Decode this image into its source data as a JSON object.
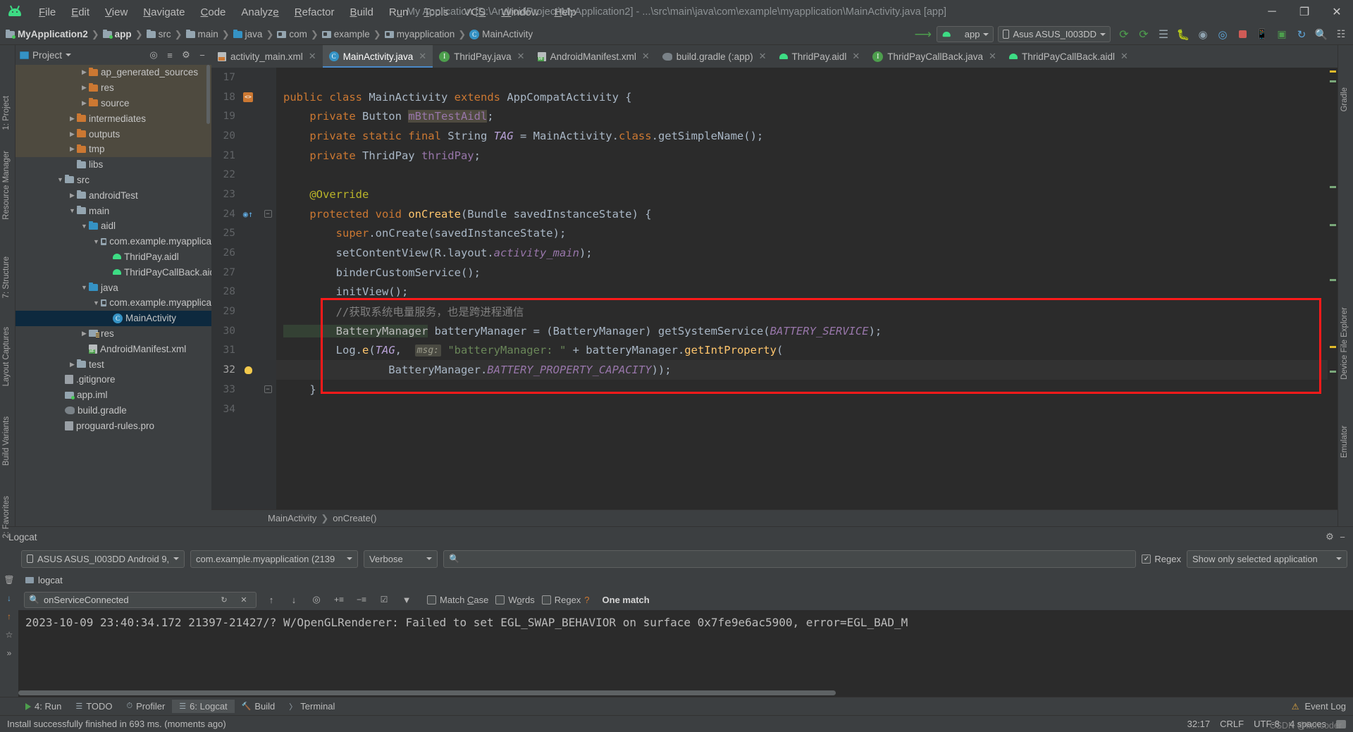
{
  "window": {
    "title": "My Application [D:\\AndroidProject\\MyApplication2] - ...\\src\\main\\java\\com\\example\\myapplication\\MainActivity.java [app]",
    "minimize": "─",
    "maximize": "❐",
    "close": "✕"
  },
  "menu": [
    {
      "label": "File"
    },
    {
      "label": "Edit"
    },
    {
      "label": "View"
    },
    {
      "label": "Navigate"
    },
    {
      "label": "Code"
    },
    {
      "label": "Analyze"
    },
    {
      "label": "Refactor"
    },
    {
      "label": "Build"
    },
    {
      "label": "Run"
    },
    {
      "label": "Tools"
    },
    {
      "label": "VCS"
    },
    {
      "label": "Window"
    },
    {
      "label": "Help"
    }
  ],
  "breadcrumb": [
    {
      "label": "MyApplication2",
      "icon": "folder-icon"
    },
    {
      "label": "app",
      "icon": "module-folder-icon"
    },
    {
      "label": "src",
      "icon": "folder-icon"
    },
    {
      "label": "main",
      "icon": "folder-icon"
    },
    {
      "label": "java",
      "icon": "source-folder-icon"
    },
    {
      "label": "com",
      "icon": "package-icon"
    },
    {
      "label": "example",
      "icon": "package-icon"
    },
    {
      "label": "myapplication",
      "icon": "package-icon"
    },
    {
      "label": "MainActivity",
      "icon": "class-icon"
    }
  ],
  "toolbar": {
    "run_config": "app",
    "device": "Asus ASUS_I003DD",
    "icons": [
      "run-icon",
      "debug-icon",
      "apply-changes-icon",
      "bug-icon",
      "profile-icon",
      "attach-debugger-icon",
      "stop-icon",
      "avd-manager-icon",
      "sdk-manager-icon",
      "sync-gradle-icon",
      "search-icon",
      "layout-inspector-icon"
    ]
  },
  "left_strip": {
    "project_label": "1: Project",
    "resource_manager_label": "Resource Manager",
    "structure_label": "7: Structure",
    "layout_captures_label": "Layout Captures",
    "build_variants_label": "Build Variants",
    "favorites_label": "2: Favorites"
  },
  "right_strip": {
    "gradle_label": "Gradle",
    "device_file_explorer_label": "Device File Explorer",
    "emulator_label": "Emulator"
  },
  "project_panel": {
    "title": "Project",
    "icons": [
      "locate-icon",
      "collapse-all-icon",
      "settings-icon",
      "hide-icon"
    ],
    "tree": [
      {
        "label": "ap_generated_sources",
        "depth": 5,
        "arrow": "▶",
        "icon": "orange-folder-icon",
        "state": "highlight"
      },
      {
        "label": "res",
        "depth": 5,
        "arrow": "▶",
        "icon": "orange-folder-icon",
        "state": "highlight"
      },
      {
        "label": "source",
        "depth": 5,
        "arrow": "▶",
        "icon": "orange-folder-icon",
        "state": "highlight"
      },
      {
        "label": "intermediates",
        "depth": 4,
        "arrow": "▶",
        "icon": "orange-folder-icon",
        "state": "highlight"
      },
      {
        "label": "outputs",
        "depth": 4,
        "arrow": "▶",
        "icon": "orange-folder-icon",
        "state": "highlight"
      },
      {
        "label": "tmp",
        "depth": 4,
        "arrow": "▶",
        "icon": "orange-folder-icon",
        "state": "highlight"
      },
      {
        "label": "libs",
        "depth": 4,
        "arrow": "",
        "icon": "folder-icon",
        "state": "normal"
      },
      {
        "label": "src",
        "depth": 3,
        "arrow": "▼",
        "icon": "folder-icon",
        "state": "normal"
      },
      {
        "label": "androidTest",
        "depth": 4,
        "arrow": "▶",
        "icon": "folder-icon",
        "state": "normal"
      },
      {
        "label": "main",
        "depth": 4,
        "arrow": "▼",
        "icon": "folder-icon",
        "state": "normal"
      },
      {
        "label": "aidl",
        "depth": 5,
        "arrow": "▼",
        "icon": "blue-folder-icon",
        "state": "normal"
      },
      {
        "label": "com.example.myapplica",
        "depth": 6,
        "arrow": "▼",
        "icon": "package-icon",
        "state": "normal"
      },
      {
        "label": "ThridPay.aidl",
        "depth": 7,
        "arrow": "",
        "icon": "android-icon",
        "state": "normal"
      },
      {
        "label": "ThridPayCallBack.aidl",
        "depth": 7,
        "arrow": "",
        "icon": "android-icon",
        "state": "normal"
      },
      {
        "label": "java",
        "depth": 5,
        "arrow": "▼",
        "icon": "blue-folder-icon",
        "state": "normal"
      },
      {
        "label": "com.example.myapplica",
        "depth": 6,
        "arrow": "▼",
        "icon": "package-icon",
        "state": "normal"
      },
      {
        "label": "MainActivity",
        "depth": 7,
        "arrow": "",
        "icon": "class-icon",
        "state": "selected"
      },
      {
        "label": "res",
        "depth": 5,
        "arrow": "▶",
        "icon": "res-folder-icon",
        "state": "normal"
      },
      {
        "label": "AndroidManifest.xml",
        "depth": 5,
        "arrow": "",
        "icon": "manifest-icon",
        "state": "normal"
      },
      {
        "label": "test",
        "depth": 4,
        "arrow": "▶",
        "icon": "folder-icon",
        "state": "normal"
      },
      {
        "label": ".gitignore",
        "depth": 3,
        "arrow": "",
        "icon": "gitignore-icon",
        "state": "normal"
      },
      {
        "label": "app.iml",
        "depth": 3,
        "arrow": "",
        "icon": "iml-icon",
        "state": "normal"
      },
      {
        "label": "build.gradle",
        "depth": 3,
        "arrow": "",
        "icon": "gradle-icon",
        "state": "normal"
      },
      {
        "label": "proguard-rules.pro",
        "depth": 3,
        "arrow": "",
        "icon": "file-icon",
        "state": "normal"
      }
    ]
  },
  "editor_tabs": [
    {
      "label": "activity_main.xml",
      "icon": "xml-layout-icon",
      "active": false
    },
    {
      "label": "MainActivity.java",
      "icon": "class-icon",
      "active": true
    },
    {
      "label": "ThridPay.java",
      "icon": "interface-icon",
      "active": false
    },
    {
      "label": "AndroidManifest.xml",
      "icon": "manifest-icon",
      "active": false
    },
    {
      "label": "build.gradle (:app)",
      "icon": "gradle-icon",
      "active": false
    },
    {
      "label": "ThridPay.aidl",
      "icon": "android-icon",
      "active": false
    },
    {
      "label": "ThridPayCallBack.java",
      "icon": "interface-icon",
      "active": false
    },
    {
      "label": "ThridPayCallBack.aidl",
      "icon": "android-icon",
      "active": false
    }
  ],
  "editor": {
    "line_numbers": [
      "17",
      "18",
      "19",
      "20",
      "21",
      "22",
      "23",
      "24",
      "25",
      "26",
      "27",
      "28",
      "29",
      "30",
      "31",
      "32",
      "33",
      "34"
    ],
    "current_line": "32",
    "breadcrumb": [
      "MainActivity",
      "onCreate()"
    ],
    "code_lines": [
      {
        "n": "17",
        "segments": []
      },
      {
        "n": "18",
        "segments": [
          {
            "t": "public ",
            "c": "kw"
          },
          {
            "t": "class ",
            "c": "kw"
          },
          {
            "t": "MainActivity ",
            "c": "txt"
          },
          {
            "t": "extends ",
            "c": "kw"
          },
          {
            "t": "AppCompatActivity {",
            "c": "txt"
          }
        ]
      },
      {
        "n": "19",
        "segments": [
          {
            "t": "    private ",
            "c": "kw"
          },
          {
            "t": "Button ",
            "c": "txt"
          },
          {
            "t": "mBtnTestAidl",
            "c": "fieldhl"
          },
          {
            "t": ";",
            "c": "txt"
          }
        ]
      },
      {
        "n": "20",
        "segments": [
          {
            "t": "    private static final ",
            "c": "kw"
          },
          {
            "t": "String ",
            "c": "txt"
          },
          {
            "t": "TAG",
            "c": "static-it"
          },
          {
            "t": " = MainActivity.",
            "c": "txt"
          },
          {
            "t": "class",
            "c": "kw"
          },
          {
            "t": ".getSimpleName();",
            "c": "txt"
          }
        ]
      },
      {
        "n": "21",
        "segments": [
          {
            "t": "    private ",
            "c": "kw"
          },
          {
            "t": "ThridPay ",
            "c": "txt"
          },
          {
            "t": "thridPay",
            "c": "field"
          },
          {
            "t": ";",
            "c": "txt"
          }
        ]
      },
      {
        "n": "22",
        "segments": []
      },
      {
        "n": "23",
        "segments": [
          {
            "t": "    @Override",
            "c": "anno"
          }
        ]
      },
      {
        "n": "24",
        "segments": [
          {
            "t": "    protected void ",
            "c": "kw"
          },
          {
            "t": "onCreate",
            "c": "meth"
          },
          {
            "t": "(Bundle savedInstanceState) {",
            "c": "txt"
          }
        ]
      },
      {
        "n": "25",
        "segments": [
          {
            "t": "        super",
            "c": "kw"
          },
          {
            "t": ".onCreate(savedInstanceState);",
            "c": "txt"
          }
        ]
      },
      {
        "n": "26",
        "segments": [
          {
            "t": "        setContentView(R.layout.",
            "c": "txt"
          },
          {
            "t": "activity_main",
            "c": "ital"
          },
          {
            "t": ");",
            "c": "txt"
          }
        ]
      },
      {
        "n": "27",
        "segments": [
          {
            "t": "        binderCustomService();",
            "c": "txt"
          }
        ]
      },
      {
        "n": "28",
        "segments": [
          {
            "t": "        initView();",
            "c": "txt"
          }
        ]
      },
      {
        "n": "29",
        "segments": [
          {
            "t": "        //获取系统电量服务，也是跨进程通信",
            "c": "cmt"
          }
        ]
      },
      {
        "n": "30",
        "segments": [
          {
            "t": "        BatteryManager",
            "c": "varhl"
          },
          {
            "t": " batteryManager = (BatteryManager) getSystemService(",
            "c": "txt"
          },
          {
            "t": "BATTERY_SERVICE",
            "c": "ital"
          },
          {
            "t": ");",
            "c": "txt"
          }
        ]
      },
      {
        "n": "31",
        "segments": [
          {
            "t": "        Log.",
            "c": "txt"
          },
          {
            "t": "e",
            "c": "meth"
          },
          {
            "t": "(",
            "c": "txt"
          },
          {
            "t": "TAG",
            "c": "static-it"
          },
          {
            "t": ",  ",
            "c": "txt"
          },
          {
            "t": "msg:",
            "c": "hint"
          },
          {
            "t": " ",
            "c": "txt"
          },
          {
            "t": "\"batteryManager: \"",
            "c": "str"
          },
          {
            "t": " + batteryManager.",
            "c": "txt"
          },
          {
            "t": "getIntProperty",
            "c": "meth"
          },
          {
            "t": "(",
            "c": "txt"
          }
        ]
      },
      {
        "n": "32",
        "segments": [
          {
            "t": "                BatteryManager.",
            "c": "txt"
          },
          {
            "t": "BATTERY_PROPERTY_CAPACITY",
            "c": "ital"
          },
          {
            "t": "));",
            "c": "txt"
          }
        ]
      },
      {
        "n": "33",
        "segments": [
          {
            "t": "    }",
            "c": "txt"
          }
        ]
      },
      {
        "n": "34",
        "segments": []
      }
    ]
  },
  "logcat": {
    "title": "Logcat",
    "device": "ASUS ASUS_I003DD Android 9, /",
    "process": "com.example.myapplication (2139",
    "level": "Verbose",
    "search_placeholder": "",
    "regex_label": "Regex",
    "regex_checked": true,
    "filter": "Show only selected application",
    "tab_label": "logcat",
    "find_value": "onServiceConnected",
    "match_case_label": "Match Case",
    "words_label": "Words",
    "find_regex_label": "Regex",
    "help_label": "?",
    "match_count": "One match",
    "output": "2023-10-09 23:40:34.172 21397-21427/? W/OpenGLRenderer: Failed to set EGL_SWAP_BEHAVIOR on surface 0x7fe9e6ac5900, error=EGL_BAD_M"
  },
  "tool_windows": [
    {
      "label": "4: Run",
      "icon": "run-icon",
      "active": false
    },
    {
      "label": "TODO",
      "icon": "todo-icon",
      "active": false
    },
    {
      "label": "Profiler",
      "icon": "profiler-icon",
      "active": false
    },
    {
      "label": "6: Logcat",
      "icon": "logcat-icon",
      "active": true
    },
    {
      "label": "Build",
      "icon": "build-icon",
      "active": false
    },
    {
      "label": "Terminal",
      "icon": "terminal-icon",
      "active": false
    }
  ],
  "event_log": "Event Log",
  "status": {
    "message": "Install successfully finished in 693 ms. (moments ago)",
    "caret": "32:17",
    "line_sep": "CRLF",
    "encoding": "UTF-8",
    "indent": "4 spaces",
    "watermark": "CSDN @fishcoder"
  },
  "colors": {
    "accent": "#4a88c7",
    "selection": "#0d293e",
    "highlight": "#4e4a3f",
    "redbox": "#ff1a1a",
    "green": "#3ddc84"
  }
}
